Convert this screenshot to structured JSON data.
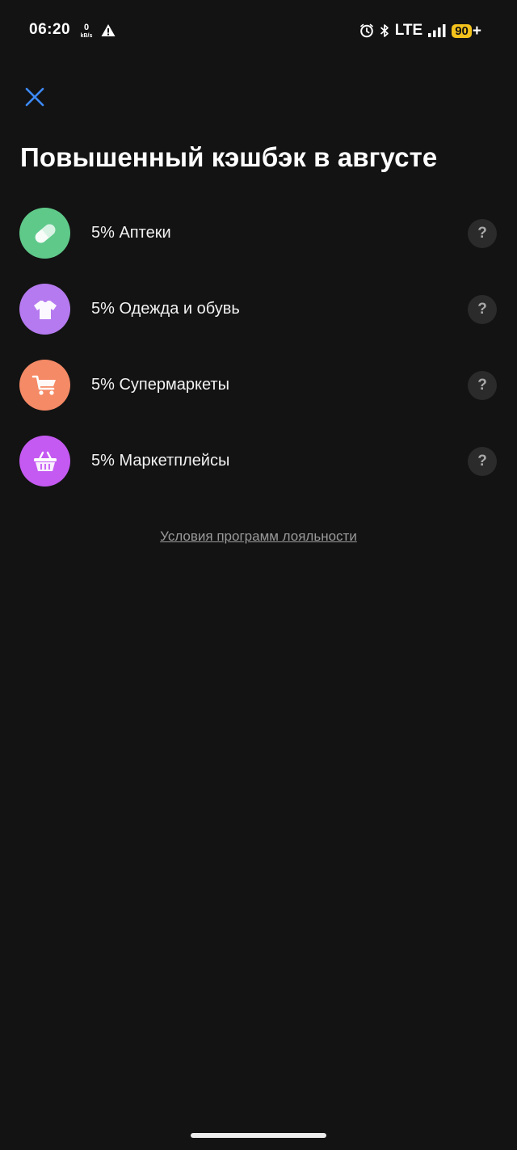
{
  "status_bar": {
    "time": "06:20",
    "net_speed_value": "0",
    "net_speed_unit": "kB/s",
    "network": "LTE",
    "battery": "90",
    "battery_suffix": "+"
  },
  "header": {
    "title": "Повышенный кэшбэк в августе",
    "close_icon": "close-icon"
  },
  "categories": [
    {
      "label": "5% Аптеки",
      "icon": "pill-icon",
      "color": "#5fc98a"
    },
    {
      "label": "5% Одежда и обувь",
      "icon": "tshirt-icon",
      "color": "#b57af0"
    },
    {
      "label": "5% Супермаркеты",
      "icon": "cart-icon",
      "color": "#f58a66"
    },
    {
      "label": "5% Маркетплейсы",
      "icon": "basket-icon",
      "color": "#c45af2"
    }
  ],
  "help_label": "?",
  "footer": {
    "loyalty_link": "Условия программ лояльности"
  },
  "colors": {
    "background": "#131313",
    "accent": "#3d8af7",
    "battery": "#f4c21c"
  }
}
